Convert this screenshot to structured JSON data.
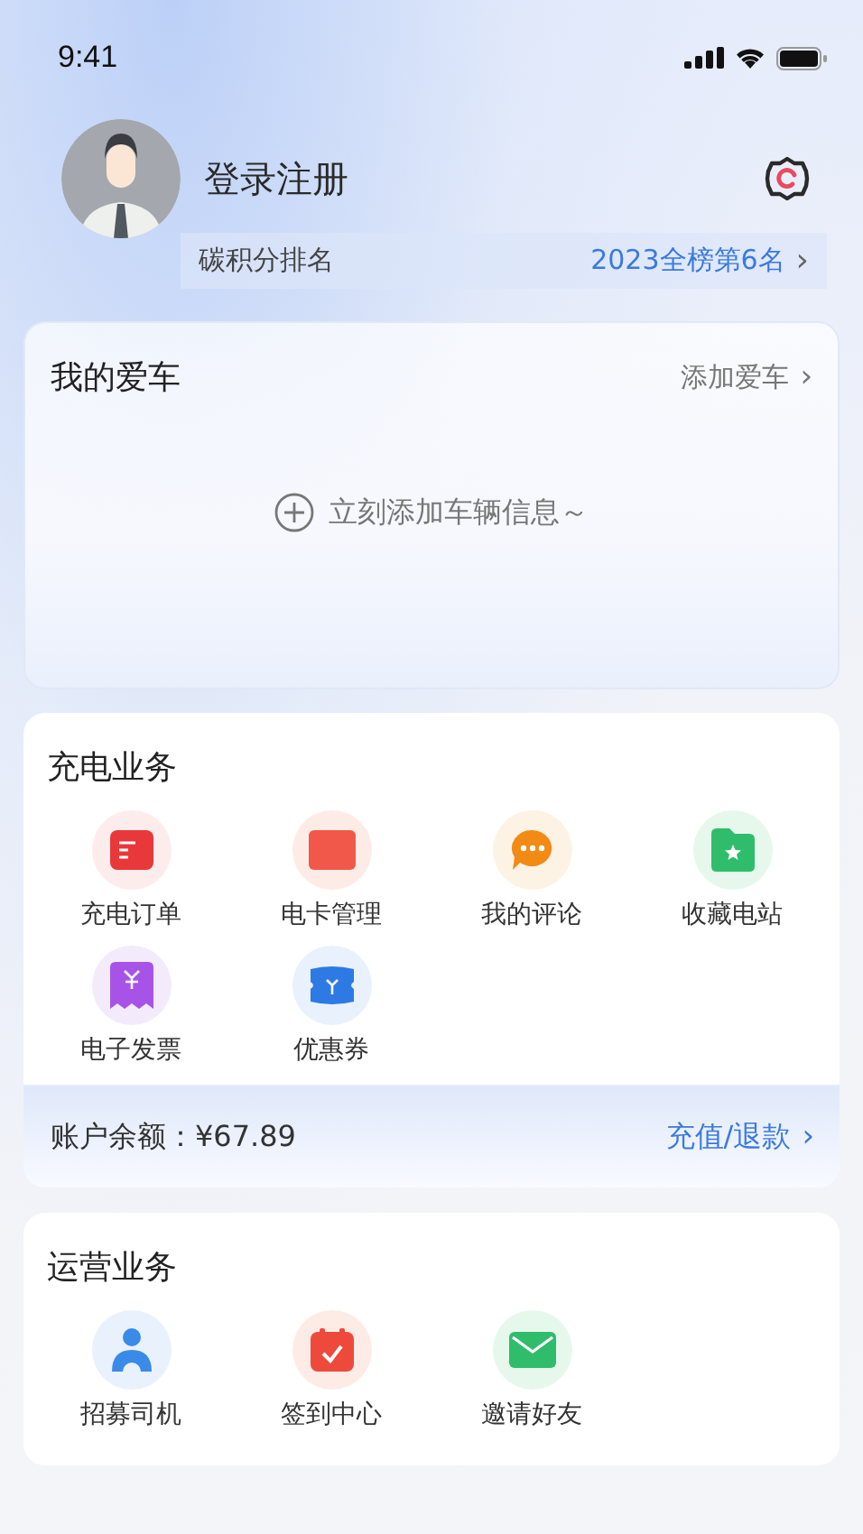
{
  "status_bar": {
    "time": "9:41"
  },
  "profile": {
    "name": "登录注册",
    "rank_label": "碳积分排名",
    "rank_value": "2023全榜第6名",
    "rank_arrow": "›"
  },
  "my_car": {
    "title": "我的爱车",
    "action": "添加爱车",
    "action_arrow": "›",
    "empty_hint": "立刻添加车辆信息～"
  },
  "charging": {
    "title": "充电业务",
    "items": [
      {
        "label": "充电订单",
        "kind": "order"
      },
      {
        "label": "电卡管理",
        "kind": "card"
      },
      {
        "label": "我的评论",
        "kind": "comment"
      },
      {
        "label": "收藏电站",
        "kind": "favorite"
      },
      {
        "label": "电子发票",
        "kind": "invoice"
      },
      {
        "label": "优惠券",
        "kind": "coupon"
      }
    ],
    "balance": "账户余额：¥67.89",
    "balance_action": "充值/退款",
    "balance_arrow": "›"
  },
  "operations": {
    "title": "运营业务",
    "items": [
      {
        "label": "招募司机",
        "kind": "driver"
      },
      {
        "label": "签到中心",
        "kind": "checkin"
      },
      {
        "label": "邀请好友",
        "kind": "invite"
      }
    ]
  }
}
